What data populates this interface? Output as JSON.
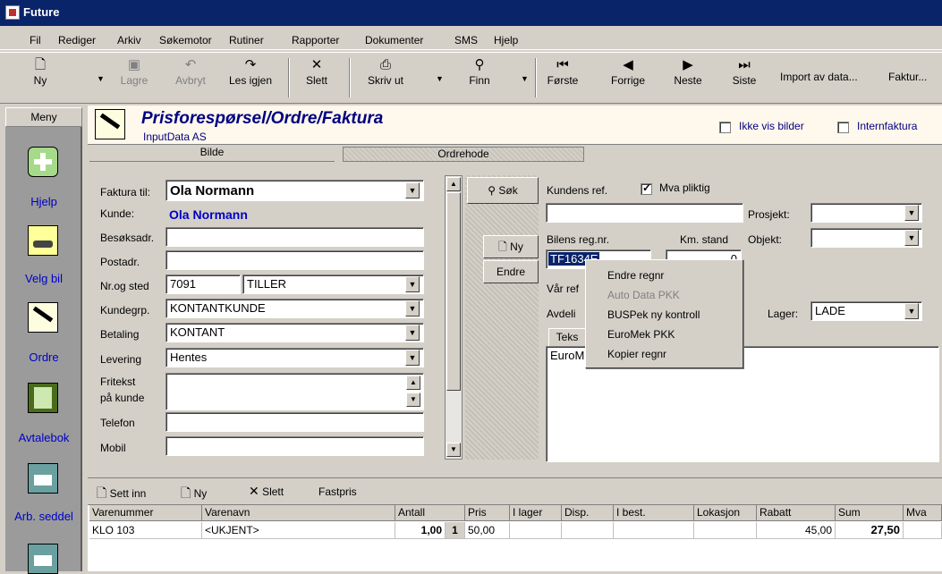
{
  "window": {
    "title": "Future"
  },
  "menu": [
    "Fil",
    "Rediger",
    "Arkiv",
    "Søkemotor",
    "Rutiner",
    "Rapporter",
    "Dokumenter",
    "SMS",
    "Hjelp"
  ],
  "toolbar": {
    "ny": "Ny",
    "lagre": "Lagre",
    "avbryt": "Avbryt",
    "les_igjen": "Les igjen",
    "slett": "Slett",
    "skriv_ut": "Skriv ut",
    "finn": "Finn",
    "forste": "Første",
    "forrige": "Forrige",
    "neste": "Neste",
    "siste": "Siste",
    "import": "Import av data...",
    "faktura": "Faktur..."
  },
  "sidebar": {
    "header": "Meny",
    "items": [
      {
        "label": "Hjelp",
        "icon": "plus-icon"
      },
      {
        "label": "Velg bil",
        "icon": "car-icon"
      },
      {
        "label": "Ordre",
        "icon": "pen-icon"
      },
      {
        "label": "Avtalebok",
        "icon": "notebook-icon"
      },
      {
        "label": "Arb. seddel",
        "icon": "printer-icon"
      }
    ]
  },
  "header": {
    "title": "Prisforespørsel/Ordre/Faktura",
    "subtitle": "InputData AS",
    "ikke_vis_bilder": "Ikke vis bilder",
    "internfaktura": "Internfaktura"
  },
  "tabs": {
    "bilde": "Bilde",
    "ordrehode": "Ordrehode"
  },
  "form": {
    "faktura_til_label": "Faktura til:",
    "faktura_til_value": "Ola Normann",
    "kunde_label": "Kunde:",
    "kunde_value": "Ola Normann",
    "besoksadr_label": "Besøksadr.",
    "postadr_label": "Postadr.",
    "nr_og_sted_label": "Nr.og sted",
    "postnr": "7091",
    "sted": "TILLER",
    "kundegrp_label": "Kundegrp.",
    "kundegrp_value": "KONTANTKUNDE",
    "betaling_label": "Betaling",
    "betaling_value": "KONTANT",
    "levering_label": "Levering",
    "levering_value": "Hentes",
    "fritekst_label1": "Fritekst",
    "fritekst_label2": "på kunde",
    "telefon_label": "Telefon",
    "mobil_label": "Mobil"
  },
  "buttons": {
    "sok": "Søk",
    "ny": "Ny",
    "endre": "Endre"
  },
  "right": {
    "kundens_ref": "Kundens ref.",
    "mva_pliktig": "Mva pliktig",
    "prosjekt": "Prosjekt:",
    "objekt": "Objekt:",
    "bilens_regnr": "Bilens reg.nr.",
    "km_stand": "Km. stand",
    "regnr_value": "TF1634E",
    "km_value": "0",
    "var_ref": "Vår ref",
    "avdeling": "Avdeli",
    "lager_label": "Lager:",
    "lager_value": "LADE",
    "tekst_tab": "Teks",
    "tekst_value": "EuroM"
  },
  "context_menu": [
    {
      "label": "Endre regnr",
      "enabled": true
    },
    {
      "label": "Auto Data PKK",
      "enabled": false
    },
    {
      "label": "BUSPek ny kontroll",
      "enabled": true
    },
    {
      "label": "EuroMek PKK",
      "enabled": true
    },
    {
      "label": "Kopier regnr",
      "enabled": true
    }
  ],
  "line_toolbar": {
    "sett_inn": "Sett inn",
    "ny": "Ny",
    "slett": "Slett",
    "fastpris": "Fastpris"
  },
  "grid": {
    "headers": [
      "Varenummer",
      "Varenavn",
      "Antall",
      "Pris",
      "I lager",
      "Disp.",
      "I best.",
      "Lokasjon",
      "Rabatt",
      "Sum",
      "Mva"
    ],
    "rows": [
      {
        "varenummer": "KLO 103",
        "varenavn": "<UKJENT>",
        "antall": "1,00",
        "antall2": "1",
        "pris": "50,00",
        "rabatt": "45,00",
        "sum": "27,50"
      }
    ]
  }
}
